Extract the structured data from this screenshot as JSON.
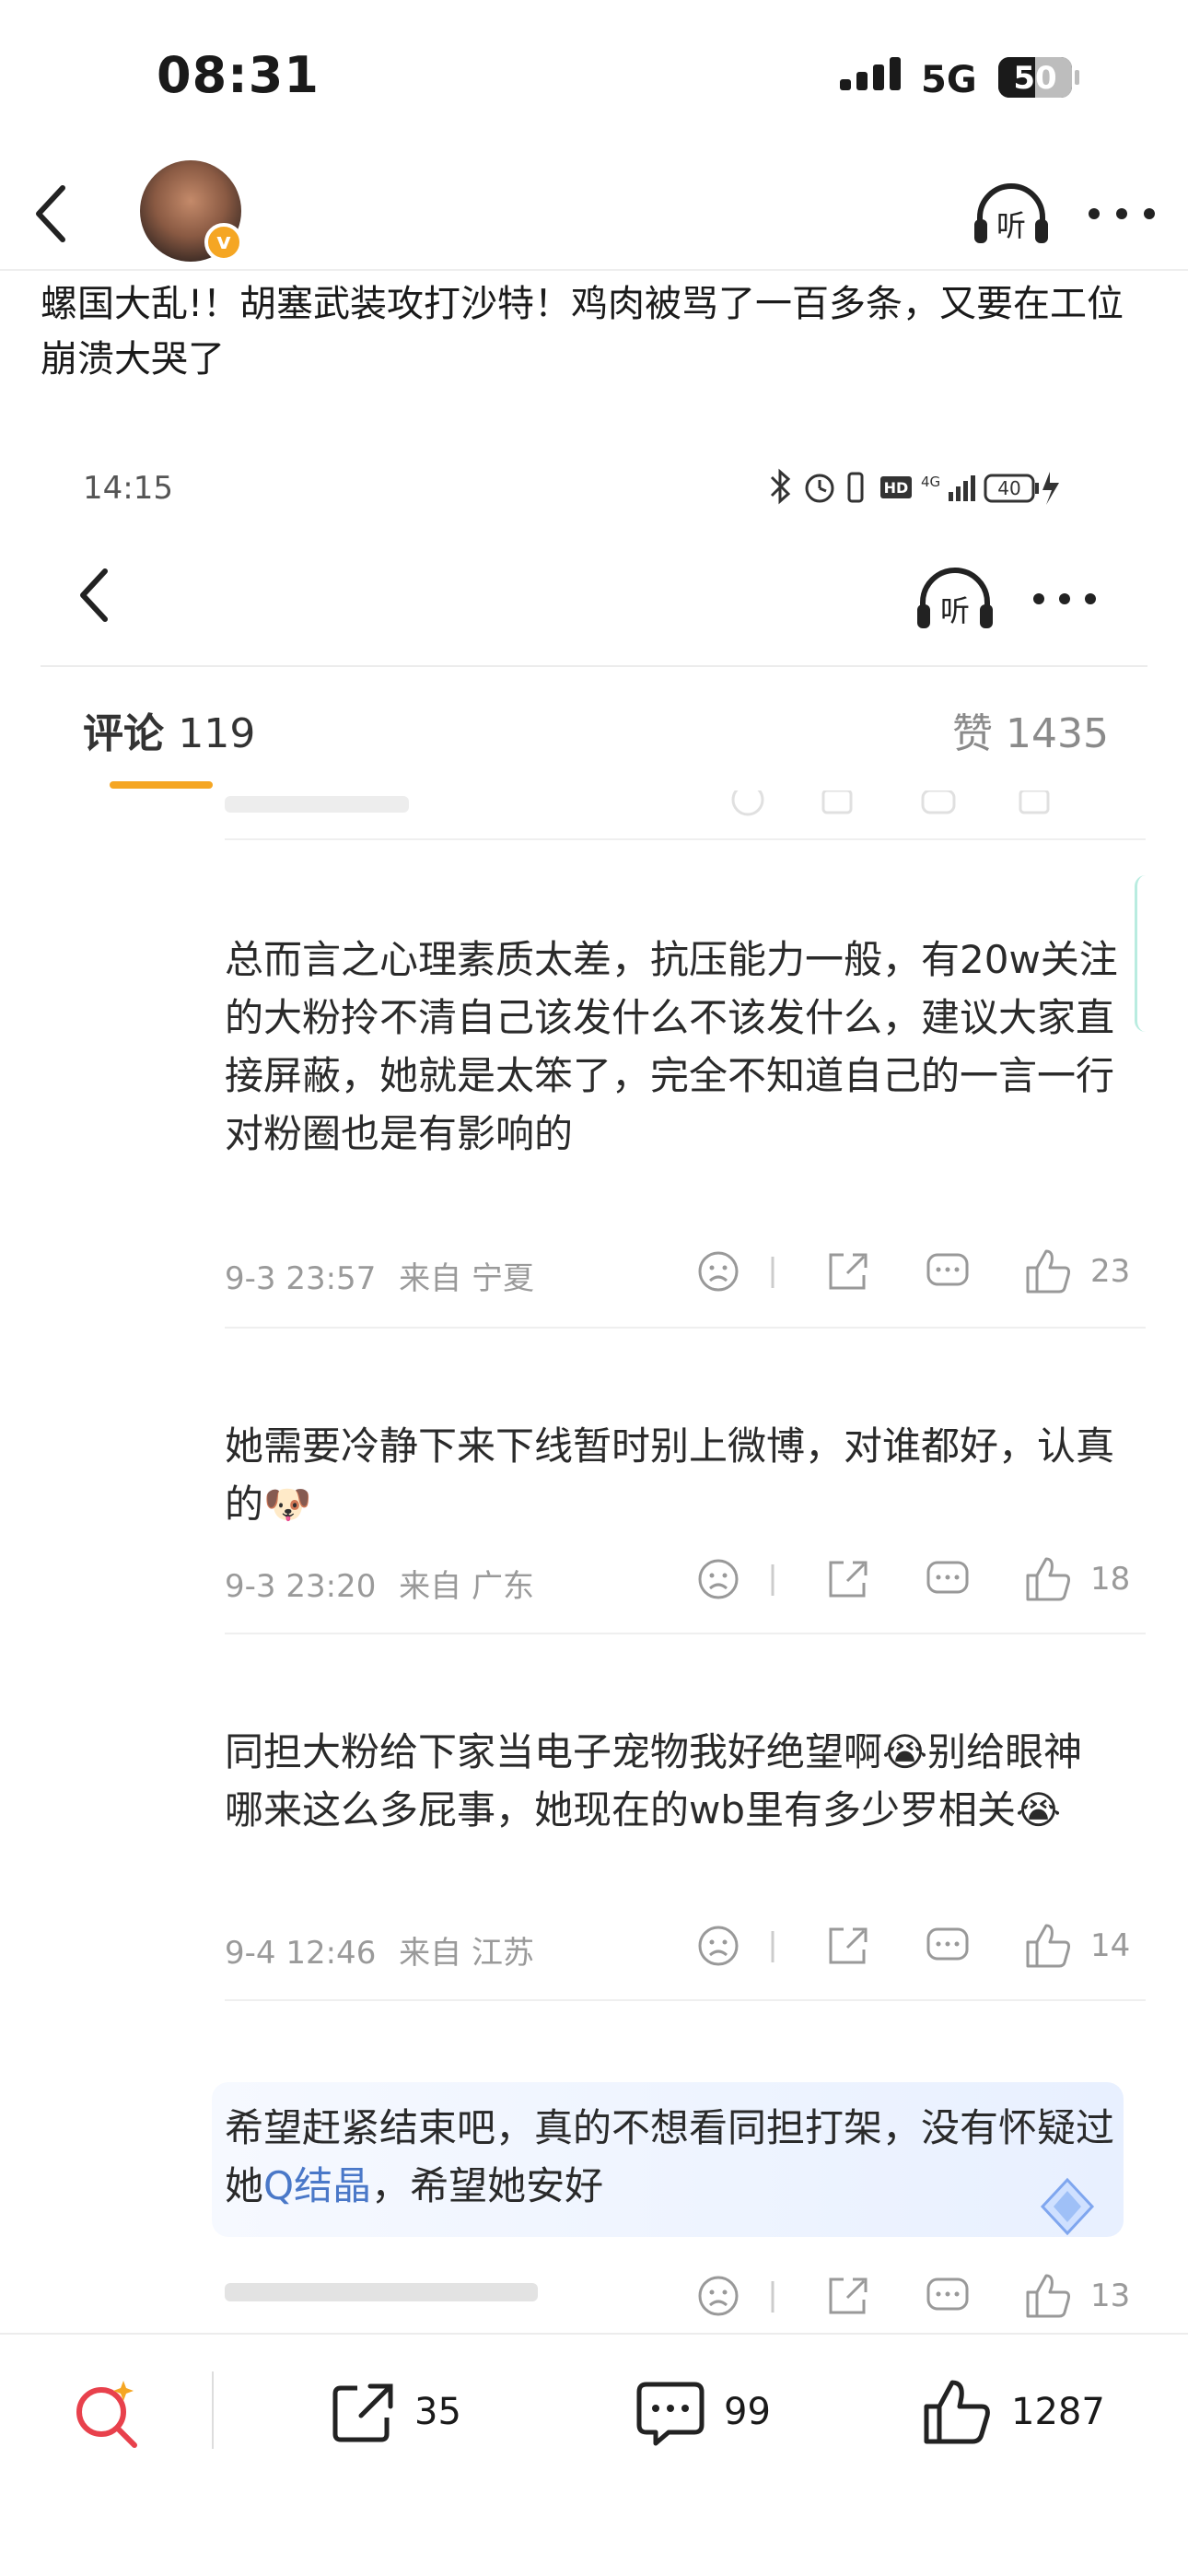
{
  "status_bar": {
    "time": "08:31",
    "network": "5G",
    "battery": "50",
    "battery_level": 0.5
  },
  "header": {
    "back_icon": "chevron-left-icon",
    "listen_label": "听",
    "verified_badge": "v"
  },
  "post": {
    "text": "螺国大乱!！胡塞武装攻打沙特！鸡肉被骂了一百多条，又要在工位崩溃大哭了"
  },
  "screenshot": {
    "time": "14:15",
    "battery": "40",
    "listen_label": "听",
    "comments_label": "评论",
    "comments_count": "119",
    "likes_label": "赞 1435",
    "comments": [
      {
        "text": "总而言之心理素质太差，抗压能力一般，有20w关注的大粉拎不清自己该发什么不该发什么，建议大家直接屏蔽，她就是太笨了，完全不知道自己的一言一行对粉圈也是有影响的",
        "time": "9-3 23:57",
        "source": "来自 宁夏",
        "likes": "23"
      },
      {
        "text": "她需要冷静下来下线暂时别上微博，对谁都好，认真的🐶",
        "time": "9-3 23:20",
        "source": "来自 广东",
        "likes": "18"
      },
      {
        "text": "同担大粉给下家当电子宠物我好绝望啊😭别给眼神哪来这么多屁事，她现在的wb里有多少罗相关😭",
        "time": "9-4 12:46",
        "source": "来自 江苏",
        "likes": "14"
      },
      {
        "text_before": "希望赶紧结束吧，真的不想看同担打架，没有怀疑过她",
        "topic": "Q结晶",
        "text_after": "，希望她安好",
        "likes": "13"
      }
    ]
  },
  "bottom_bar": {
    "repost_count": "35",
    "comment_count": "99",
    "like_count": "1287"
  },
  "colors": {
    "accent": "#f5a623",
    "topic": "#4a78c8",
    "search_icon": "#e8414c"
  }
}
